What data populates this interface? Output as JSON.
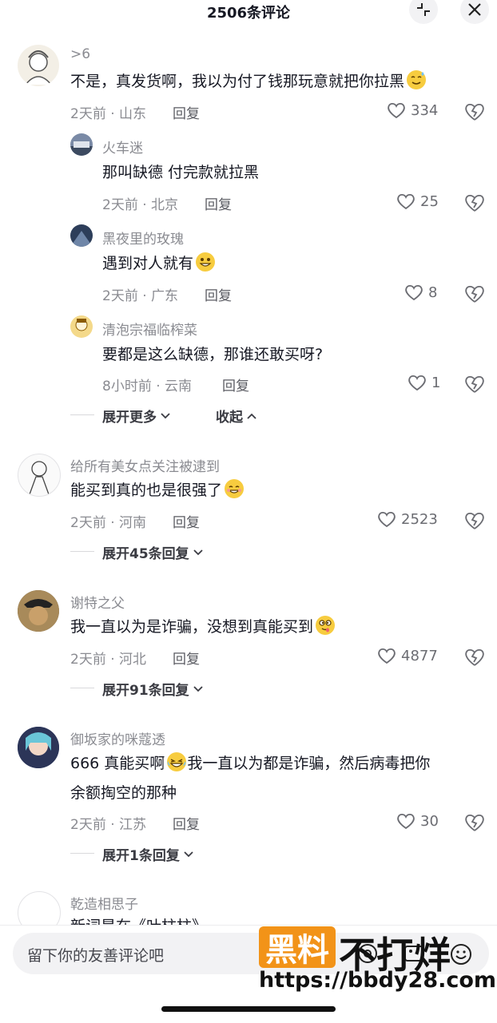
{
  "header": {
    "title": "2506条评论"
  },
  "comments": [
    {
      "name": ">6",
      "text": "不是，真发货啊，我以为付了钱那玩意就把你拉黑",
      "emoji": "sweat-smile",
      "meta": "2天前 · 山东",
      "reply": "回复",
      "likes": "334",
      "replies": [
        {
          "name": "火车迷",
          "text": "那叫缺德 付完款就拉黑",
          "meta": "2天前 · 北京",
          "reply": "回复",
          "likes": "25"
        },
        {
          "name": "黑夜里的玫瑰",
          "text": "遇到对人就有",
          "emoji": "grin",
          "meta": "2天前 · 广东",
          "reply": "回复",
          "likes": "8"
        },
        {
          "name": "清泡宗福临榨菜",
          "text": "要都是这么缺德，那谁还敢买呀?",
          "meta": "8小时前 · 云南",
          "reply": "回复",
          "likes": "1"
        }
      ],
      "expand_more": "展开更多",
      "collapse": "收起"
    },
    {
      "name": "给所有美女点关注被逮到",
      "text": "能买到真的也是很强了",
      "emoji": "blush",
      "meta": "2天前 · 河南",
      "reply": "回复",
      "likes": "2523",
      "expand": "展开45条回复"
    },
    {
      "name": "谢特之父",
      "text": "我一直以为是诈骗，没想到真能买到",
      "emoji": "dizzy",
      "meta": "2天前 · 河北",
      "reply": "回复",
      "likes": "4877",
      "expand": "展开91条回复"
    },
    {
      "name": "御坂家的咪蔻透",
      "text": "666 真能买啊",
      "text2": "我一直以为都是诈骗，然后病毒把你",
      "text3": "余额掏空的那种",
      "emoji": "laugh-cry",
      "meta": "2天前 · 江苏",
      "reply": "回复",
      "likes": "30",
      "expand": "展开1条回复"
    },
    {
      "name": "乾造相思子",
      "text": "新词是在《叶柱柱》"
    }
  ],
  "input": {
    "placeholder": "留下你的友善评论吧"
  },
  "watermark": {
    "box": "黑料",
    "text": "不打烊",
    "url": "https://bbdy28.com"
  },
  "colors": {
    "heart": "#6b6c72",
    "text": "#161823",
    "meta": "#8a8b91",
    "watermark": "#f29318"
  }
}
